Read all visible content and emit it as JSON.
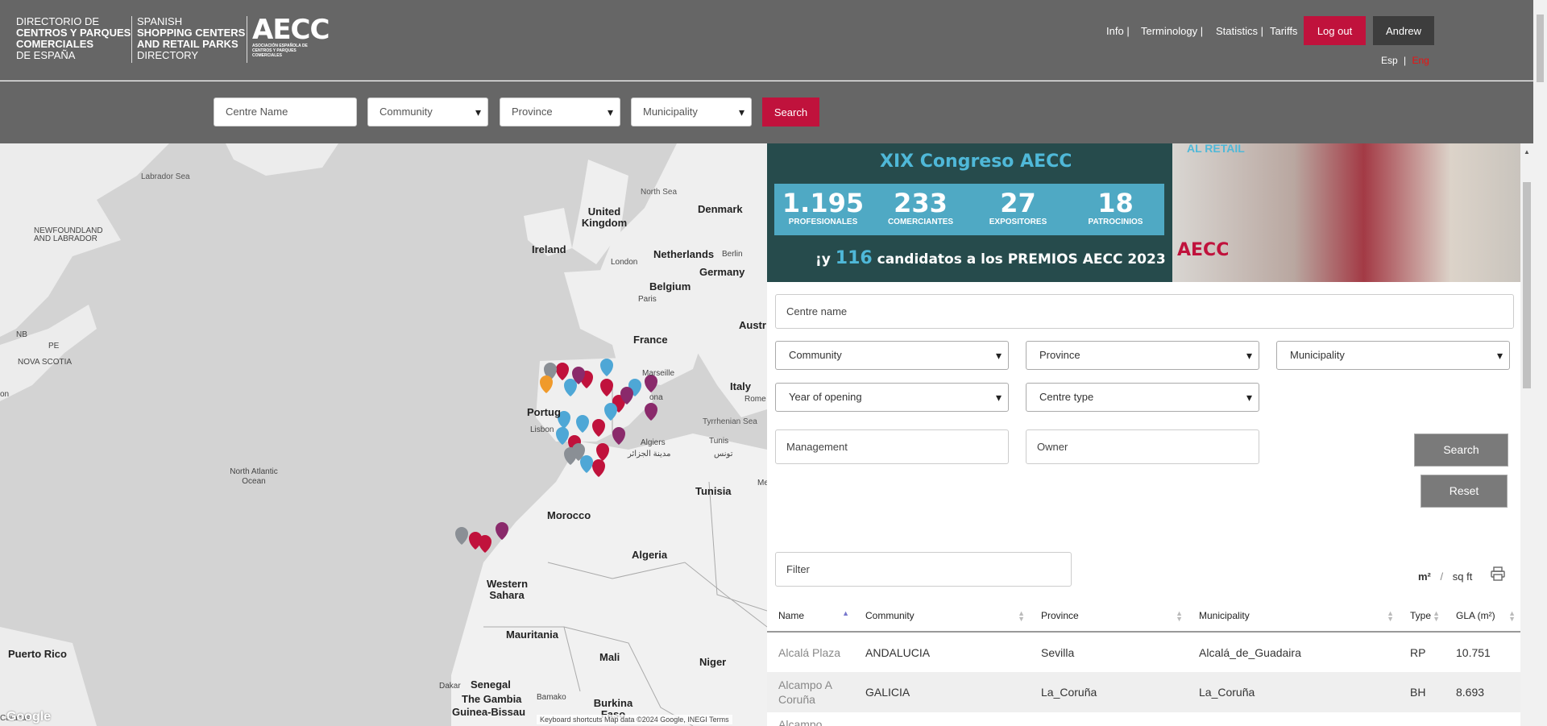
{
  "header": {
    "directory_es": [
      "DIRECTORIO DE",
      "CENTROS Y PARQUES",
      "COMERCIALES",
      "DE ESPAÑA"
    ],
    "directory_en": [
      "SPANISH",
      "SHOPPING CENTERS",
      "AND RETAIL PARKS",
      "DIRECTORY"
    ],
    "logo_word": "AECC",
    "logo_sub": "ASOCIACIÓN ESPAÑOLA DE CENTROS Y PARQUES COMERCIALES",
    "nav": [
      "Info",
      "Terminology",
      "Statistics",
      "Tariffs"
    ],
    "logout_label": "Log out",
    "user_label": "Andrew",
    "lang_es": "Esp",
    "lang_en": "Eng"
  },
  "topsearch": {
    "centre_placeholder": "Centre Name",
    "community": "Community",
    "province": "Province",
    "municipality": "Municipality",
    "search_label": "Search"
  },
  "map": {
    "labels": {
      "labrador_sea": "Labrador Sea",
      "newfoundland": "NEWFOUNDLAND AND LABRADOR",
      "nb": "NB",
      "pe": "PE",
      "nova_scotia": "NOVA SCOTIA",
      "on": "on",
      "north_sea": "North Sea",
      "united_kingdom": "United Kingdom",
      "denmark": "Denmark",
      "ireland": "Ireland",
      "netherlands": "Netherlands",
      "berlin": "Berlin",
      "london": "London",
      "germany": "Germany",
      "belgium": "Belgium",
      "paris": "Paris",
      "austria": "Austr",
      "france": "France",
      "marseille": "Marseille",
      "italy": "Italy",
      "rome": "Rome",
      "portugal": "Portug",
      "ona": "ona",
      "lisbon": "Lisbon",
      "tyrrhenian": "Tyrrhenian Sea",
      "algiers": "Algiers",
      "algiers_ar": "مدينة الجزائر",
      "tunis": "Tunis",
      "tunis_ar": "تونس",
      "north_atlantic": "North Atlantic Ocean",
      "tunisia": "Tunisia",
      "morocco": "Morocco",
      "algeria": "Algeria",
      "western_sahara": "Western Sahara",
      "mauritania": "Mauritania",
      "mali": "Mali",
      "niger": "Niger",
      "puerto_rico": "Puerto Rico",
      "dakar": "Dakar",
      "senegal": "Senegal",
      "gambia": "The Gambia",
      "guinea_bissau": "Guinea-Bissau",
      "bamako": "Bamako",
      "burkina": "Burkina Faso",
      "caracas": "Caracas",
      "me": "Me"
    },
    "google": "Google",
    "attribution": "Keyboard shortcuts   Map data ©2024 Google, INEGI   Terms"
  },
  "banner": {
    "title": "XIX Congreso AECC",
    "stats": [
      {
        "num": "1.195",
        "label": "PROFESIONALES"
      },
      {
        "num": "233",
        "label": "COMERCIANTES"
      },
      {
        "num": "27",
        "label": "EXPOSITORES"
      },
      {
        "num": "18",
        "label": "PATROCINIOS"
      }
    ],
    "bottom_pre": "¡y",
    "bottom_num": "116",
    "bottom_post": "candidatos a los PREMIOS AECC 2023 !",
    "photo_text": "AL RETAIL",
    "photo_logo": "AECC"
  },
  "filters": {
    "centre_name": "Centre name",
    "community": "Community",
    "province": "Province",
    "municipality": "Municipality",
    "year_of_opening": "Year of opening",
    "centre_type": "Centre type",
    "management": "Management",
    "owner": "Owner",
    "search_label": "Search",
    "reset_label": "Reset",
    "filter_placeholder": "Filter"
  },
  "units": {
    "m2": "m²",
    "sqft": "sq ft"
  },
  "table": {
    "headers": [
      "Name",
      "Community",
      "Province",
      "Municipality",
      "Type",
      "GLA (m²)"
    ],
    "rows": [
      {
        "name": "Alcalá Plaza",
        "community": "ANDALUCIA",
        "province": "Sevilla",
        "municipality": "Alcalá_de_Guadaira",
        "type": "RP",
        "gla": "10.751"
      },
      {
        "name": "Alcampo A Coruña",
        "community": "GALICIA",
        "province": "La_Coruña",
        "municipality": "La_Coruña",
        "type": "BH",
        "gla": "8.693"
      },
      {
        "name": "Alcampo",
        "community": "",
        "province": "",
        "municipality": "",
        "type": "",
        "gla": ""
      }
    ]
  },
  "colors": {
    "accent": "#c0123c",
    "header_bg": "#666666",
    "banner_bg": "#264b4c",
    "banner_accent": "#4fb8d8"
  }
}
